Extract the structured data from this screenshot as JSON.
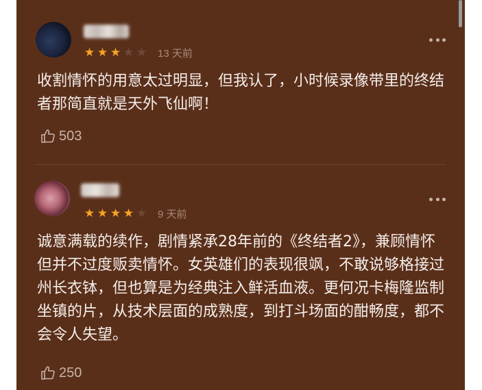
{
  "reviews": [
    {
      "rating": 3,
      "max_rating": 5,
      "time": "13 天前",
      "content": "收割情怀的用意太过明显，但我认了，小时候录像带里的终结者那简直就是天外飞仙啊！",
      "likes": "503"
    },
    {
      "rating": 4,
      "max_rating": 5,
      "time": "9 天前",
      "content": "诚意满载的续作，剧情紧承28年前的《终结者2》，兼顾情怀但并不过度贩卖情怀。女英雄们的表现很飒，不敢说够格接过州长衣钵，但也算是为经典注入鲜活血液。更何况卡梅隆监制坐镇的片，从技术层面的成熟度，到打斗场面的酣畅度，都不会令人失望。",
      "likes": "250"
    }
  ],
  "icons": {
    "star": "star-icon",
    "like": "thumbs-up-icon",
    "more": "more-icon"
  },
  "colors": {
    "background": "#5a2f1a",
    "star_on": "#f5a623",
    "text": "#f4eeea"
  }
}
